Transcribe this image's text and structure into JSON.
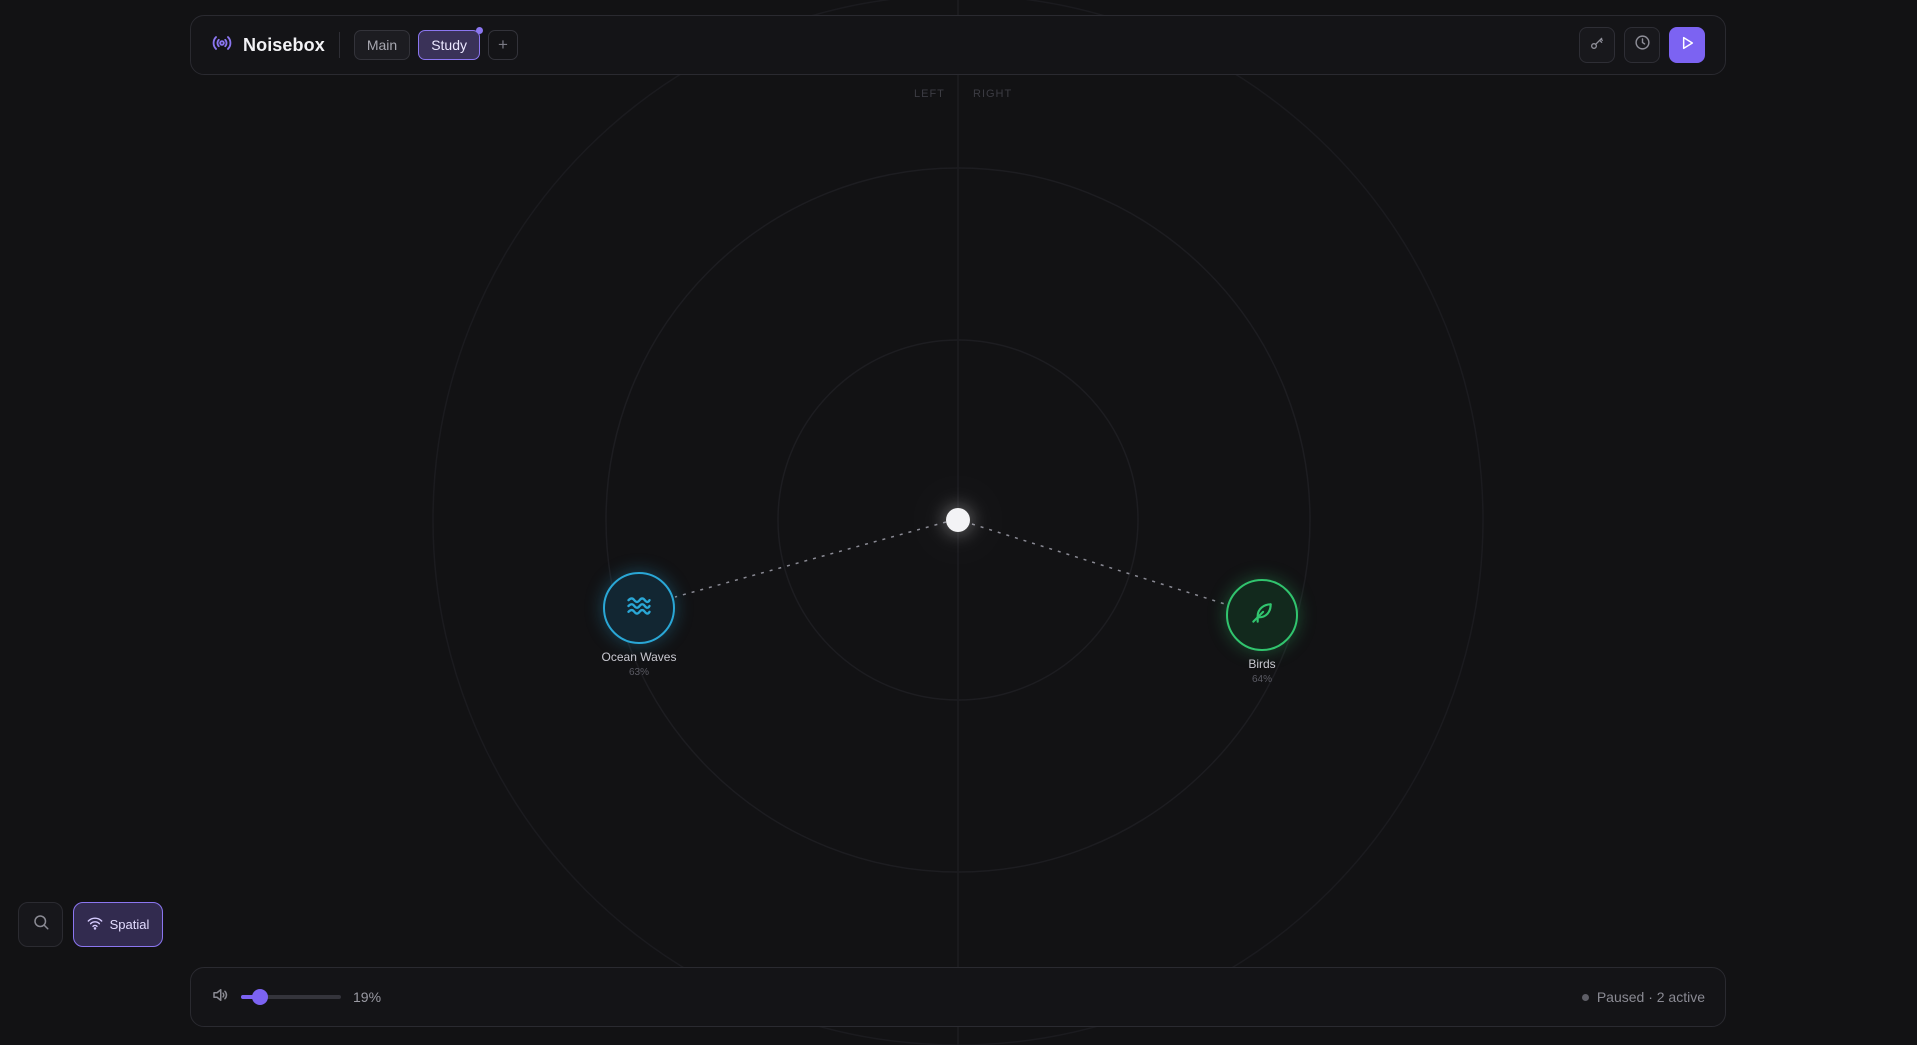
{
  "app": {
    "name": "Noisebox"
  },
  "tabs": [
    {
      "label": "Main",
      "active": false
    },
    {
      "label": "Study",
      "active": true,
      "has_indicator": true
    }
  ],
  "toolbar": {
    "add_tab_label": "+",
    "icons": [
      "key-icon",
      "clock-icon",
      "play-icon"
    ]
  },
  "canvas": {
    "left_label": "LEFT",
    "right_label": "RIGHT"
  },
  "sounds": [
    {
      "name": "Ocean Waves",
      "volume": "63%",
      "icon": "waves-icon",
      "color": "#2aa7d6"
    },
    {
      "name": "Birds",
      "volume": "64%",
      "icon": "feather-icon",
      "color": "#31c46e"
    }
  ],
  "controls": {
    "spatial_label": "Spatial"
  },
  "master": {
    "volume_percent": 19,
    "volume_text": "19%"
  },
  "status": {
    "text": "Paused · 2 active"
  },
  "colors": {
    "accent": "#7c63f2",
    "background": "#121214"
  }
}
